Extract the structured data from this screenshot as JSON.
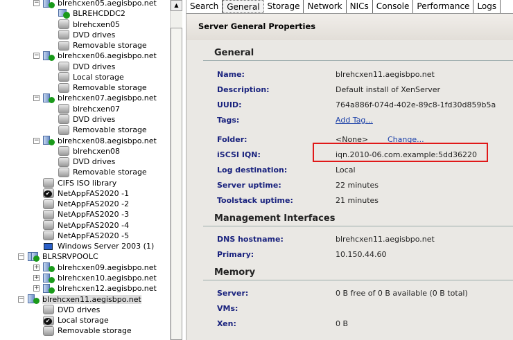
{
  "tree": [
    {
      "label": "blrehcxen05.aegisbpo.net",
      "type": "host",
      "level": 1,
      "expander": "-"
    },
    {
      "label": "BLREHCDDC2",
      "type": "vm",
      "level": 2
    },
    {
      "label": "blrehcxen05",
      "type": "disk",
      "level": 2
    },
    {
      "label": "DVD drives",
      "type": "disk",
      "level": 2
    },
    {
      "label": "Removable storage",
      "type": "disk",
      "level": 2
    },
    {
      "label": "blrehcxen06.aegisbpo.net",
      "type": "host",
      "level": 1,
      "expander": "-"
    },
    {
      "label": "DVD drives",
      "type": "disk",
      "level": 2
    },
    {
      "label": "Local storage",
      "type": "disk",
      "level": 2
    },
    {
      "label": "Removable storage",
      "type": "disk",
      "level": 2
    },
    {
      "label": "blrehcxen07.aegisbpo.net",
      "type": "host",
      "level": 1,
      "expander": "-"
    },
    {
      "label": "blrehcxen07",
      "type": "disk",
      "level": 2
    },
    {
      "label": "DVD drives",
      "type": "disk",
      "level": 2
    },
    {
      "label": "Removable storage",
      "type": "disk",
      "level": 2
    },
    {
      "label": "blrehcxen08.aegisbpo.net",
      "type": "host",
      "level": 1,
      "expander": "-"
    },
    {
      "label": "blrehcxen08",
      "type": "disk",
      "level": 2
    },
    {
      "label": "DVD drives",
      "type": "disk",
      "level": 2
    },
    {
      "label": "Removable storage",
      "type": "disk",
      "level": 2
    },
    {
      "label": "CIFS ISO library",
      "type": "disk",
      "level": 1.5
    },
    {
      "label": "NetAppFAS2020 -1",
      "type": "default",
      "level": 1.5
    },
    {
      "label": "NetAppFAS2020 -2",
      "type": "disk",
      "level": 1.5
    },
    {
      "label": "NetAppFAS2020 -3",
      "type": "disk",
      "level": 1.5
    },
    {
      "label": "NetAppFAS2020 -4",
      "type": "disk",
      "level": 1.5
    },
    {
      "label": "NetAppFAS2020 -5",
      "type": "disk",
      "level": 1.5
    },
    {
      "label": "Windows Server 2003 (1)",
      "type": "template",
      "level": 1.5
    },
    {
      "label": "BLRSRVPOOLC",
      "type": "pool",
      "level": 0,
      "expander": "-"
    },
    {
      "label": "blrehcxen09.aegisbpo.net",
      "type": "host",
      "level": 1,
      "expander": "+"
    },
    {
      "label": "blrehcxen10.aegisbpo.net",
      "type": "host",
      "level": 1,
      "expander": "+"
    },
    {
      "label": "blrehcxen12.aegisbpo.net",
      "type": "host",
      "level": 1,
      "expander": "+"
    },
    {
      "label": "blrehcxen11.aegisbpo.net",
      "type": "host",
      "level": 0,
      "expander": "-",
      "selected": true
    },
    {
      "label": "DVD drives",
      "type": "disk",
      "level": 0.5
    },
    {
      "label": "Local storage",
      "type": "default",
      "level": 0.5
    },
    {
      "label": "Removable storage",
      "type": "disk",
      "level": 0.5
    }
  ],
  "tabs": [
    "Search",
    "General",
    "Storage",
    "Network",
    "NICs",
    "Console",
    "Performance",
    "Logs"
  ],
  "active_tab": "General",
  "header": "Server General Properties",
  "sections": {
    "general": "General",
    "management": "Management Interfaces",
    "memory": "Memory"
  },
  "general": {
    "name_label": "Name:",
    "name": "blrehcxen11.aegisbpo.net",
    "description_label": "Description:",
    "description": "Default install of XenServer",
    "uuid_label": "UUID:",
    "uuid": "764a886f-074d-402e-89c8-1fd30d859b5a",
    "tags_label": "Tags:",
    "tags_link": "Add Tag...",
    "folder_label": "Folder:",
    "folder": "<None>",
    "folder_link": "Change...",
    "iqn_label": "iSCSI IQN:",
    "iqn": "iqn.2010-06.com.example:5dd36220",
    "logdest_label": "Log destination:",
    "logdest": "Local",
    "uptime_label": "Server uptime:",
    "uptime": "22 minutes",
    "toolstack_label": "Toolstack uptime:",
    "toolstack": "21 minutes"
  },
  "management": {
    "dns_label": "DNS hostname:",
    "dns": "blrehcxen11.aegisbpo.net",
    "primary_label": "Primary:",
    "primary": "10.150.44.60"
  },
  "memory": {
    "server_label": "Server:",
    "server": "0 B free of 0 B available (0 B total)",
    "vms_label": "VMs:",
    "xen_label": "Xen:",
    "xen": "0 B"
  }
}
